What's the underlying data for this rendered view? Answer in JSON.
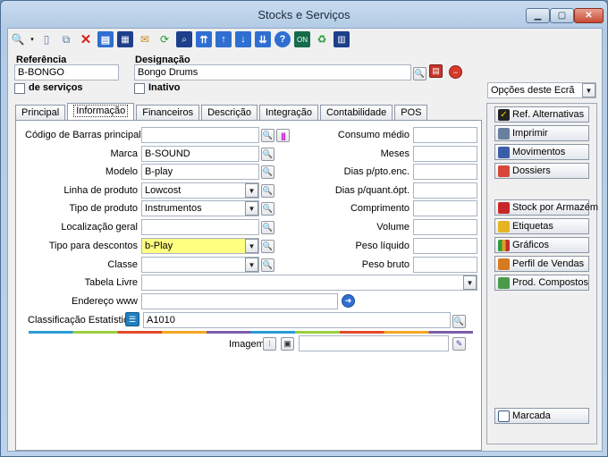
{
  "window": {
    "title": "Stocks e Serviços"
  },
  "header": {
    "referencia_label": "Referência",
    "referencia_value": "B-BONGO",
    "designacao_label": "Designação",
    "designacao_value": "Bongo Drums",
    "servicos_label": "de serviços",
    "inativo_label": "Inativo"
  },
  "opcoes": {
    "label": "Opções deste Ecrã"
  },
  "tabs": [
    "Principal",
    "Informação",
    "Financeiros",
    "Descrição",
    "Integração",
    "Contabilidade",
    "POS"
  ],
  "form": {
    "codigo_barras_label": "Código de Barras principal",
    "marca_label": "Marca",
    "marca_value": "B-SOUND",
    "modelo_label": "Modelo",
    "modelo_value": "B-play",
    "linha_label": "Linha de produto",
    "linha_value": "Lowcost",
    "tipo_produto_label": "Tipo de produto",
    "tipo_produto_value": "Instrumentos",
    "localizacao_label": "Localização geral",
    "tipo_descontos_label": "Tipo para descontos",
    "tipo_descontos_value": "b-Play",
    "classe_label": "Classe",
    "tabela_label": "Tabela Livre",
    "endereco_label": "Endereço www",
    "classificacao_label": "Classificação Estatística",
    "classificacao_value": "A1010",
    "consumo_label": "Consumo médio",
    "meses_label": "Meses",
    "dias_pto_label": "Dias p/pto.enc.",
    "dias_quant_label": "Dias p/quant.ópt.",
    "comprimento_label": "Comprimento",
    "volume_label": "Volume",
    "peso_liquido_label": "Peso líquido",
    "peso_bruto_label": "Peso bruto",
    "imagem_label": "Imagem"
  },
  "sidebar": {
    "buttons": [
      "Ref. Alternativas",
      "Imprimir",
      "Movimentos",
      "Dossiers",
      "Stock por Armazém",
      "Etiquetas",
      "Gráficos",
      "Perfil de Vendas",
      "Prod. Compostos",
      "Marcada"
    ]
  }
}
